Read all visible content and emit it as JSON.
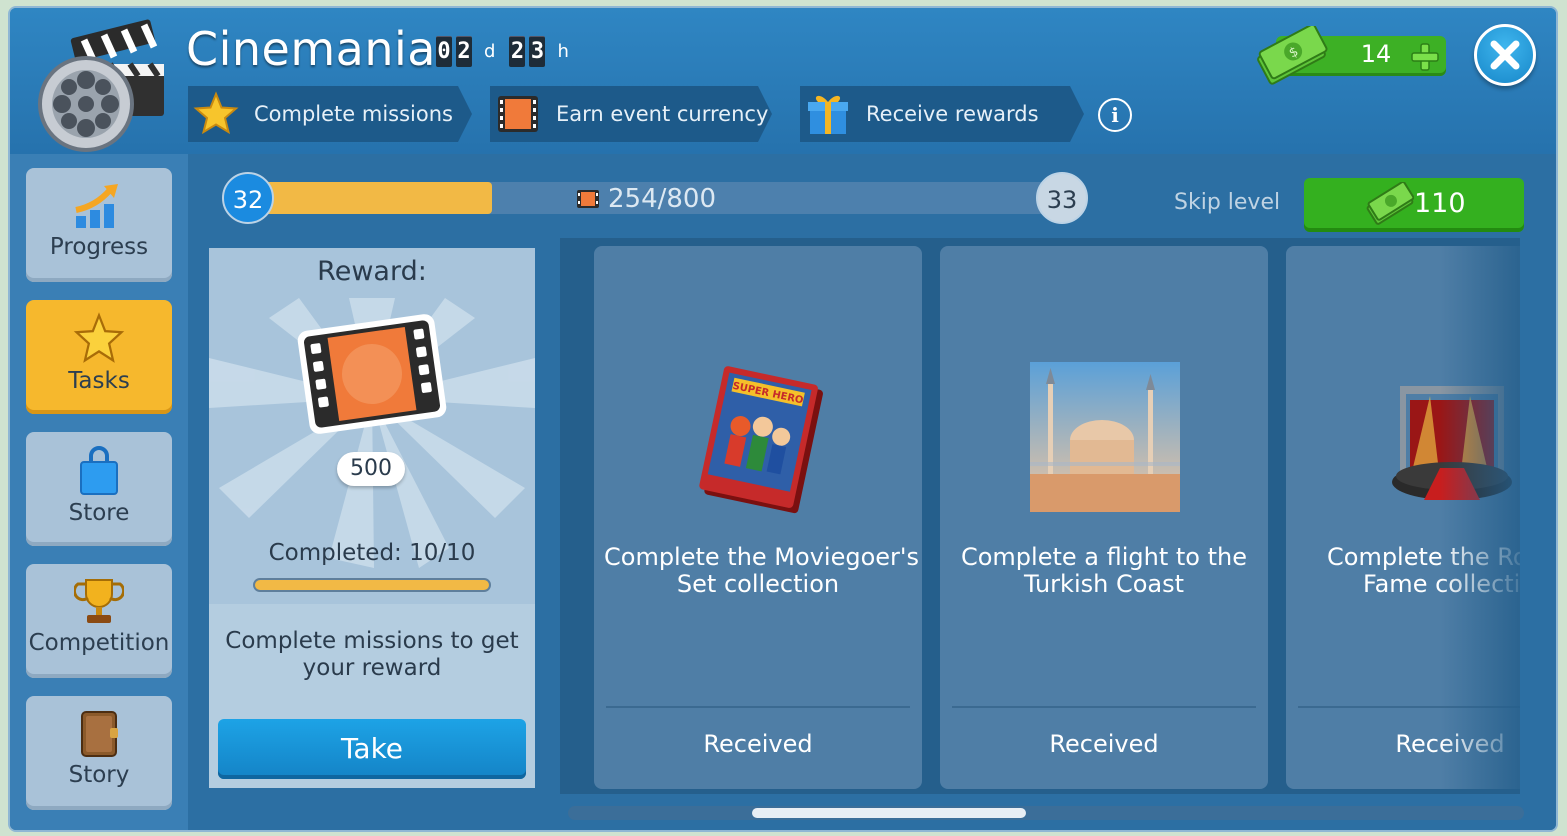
{
  "header": {
    "title": "Cinemania",
    "timer": {
      "days_digits": [
        "0",
        "2"
      ],
      "days_unit": "d",
      "hours_digits": [
        "2",
        "3"
      ],
      "hours_unit": "h"
    },
    "steps": [
      {
        "label": "Complete missions",
        "icon": "star-icon"
      },
      {
        "label": "Earn event currency",
        "icon": "film-ticket-icon"
      },
      {
        "label": "Receive rewards",
        "icon": "gift-icon"
      }
    ],
    "info_label": "i",
    "currency": {
      "value": "14",
      "icon": "cash-icon"
    }
  },
  "sidebar": {
    "items": [
      {
        "label": "Progress",
        "icon": "chart-arrow-icon",
        "active": false
      },
      {
        "label": "Tasks",
        "icon": "star-icon",
        "active": true
      },
      {
        "label": "Store",
        "icon": "shopping-bag-icon",
        "active": false
      },
      {
        "label": "Competition",
        "icon": "trophy-icon",
        "active": false
      },
      {
        "label": "Story",
        "icon": "book-icon",
        "active": false
      }
    ]
  },
  "level": {
    "current": "32",
    "next": "33",
    "progress_text": "254/800",
    "progress_fraction": 0.3175,
    "skip_label": "Skip level",
    "skip_cost": "110"
  },
  "reward": {
    "title": "Reward:",
    "amount": "500",
    "completed": "Completed: 10/10",
    "completed_fraction": 1.0,
    "description": "Complete missions to get your reward",
    "take_label": "Take"
  },
  "missions": [
    {
      "text_line1": "Complete the Moviegoer's",
      "text_line2": "Set collection",
      "status": "Received",
      "image": "comic-book-icon"
    },
    {
      "text_line1": "Complete a flight to the",
      "text_line2": "Turkish Coast",
      "status": "Received",
      "image": "mosque-photo"
    },
    {
      "text_line1": "Complete the Ro",
      "text_line2": "Fame collectio",
      "status": "Received",
      "image": "stage-icon"
    }
  ],
  "colors": {
    "header_blue": "#2f86c3",
    "active_tab": "#f6b82d",
    "green_button": "#34b01f",
    "take_button": "#1da3e6",
    "progress_fill": "#f2b945"
  }
}
